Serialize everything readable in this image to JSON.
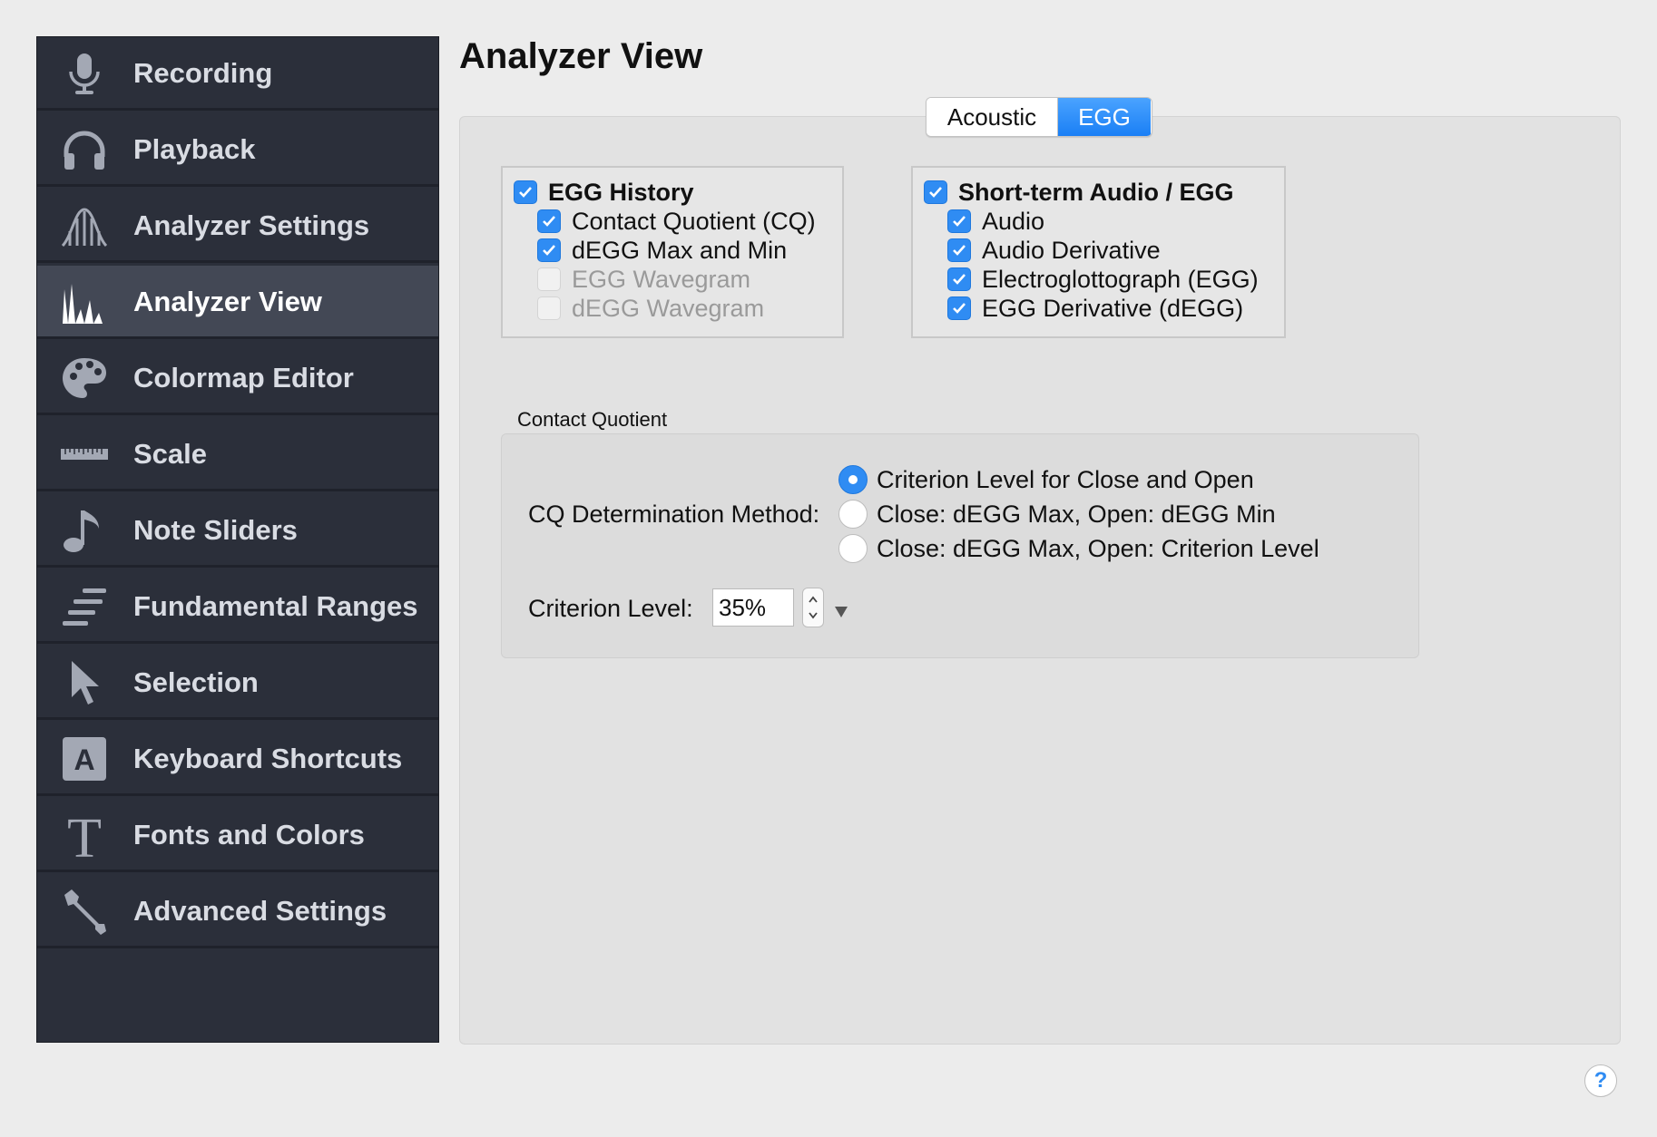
{
  "sidebar": {
    "items": [
      {
        "label": "Recording",
        "icon": "microphone-icon"
      },
      {
        "label": "Playback",
        "icon": "headphones-icon"
      },
      {
        "label": "Analyzer Settings",
        "icon": "analyzer-settings-icon"
      },
      {
        "label": "Analyzer View",
        "icon": "analyzer-view-icon",
        "active": true
      },
      {
        "label": "Colormap Editor",
        "icon": "palette-icon"
      },
      {
        "label": "Scale",
        "icon": "ruler-icon"
      },
      {
        "label": "Note Sliders",
        "icon": "music-note-icon"
      },
      {
        "label": "Fundamental Ranges",
        "icon": "ranges-icon"
      },
      {
        "label": "Selection",
        "icon": "cursor-icon"
      },
      {
        "label": "Keyboard Shortcuts",
        "icon": "keyboard-a-icon"
      },
      {
        "label": "Fonts and Colors",
        "icon": "font-t-icon"
      },
      {
        "label": "Advanced Settings",
        "icon": "wrench-icon"
      }
    ]
  },
  "page": {
    "title": "Analyzer View"
  },
  "tabs": {
    "acoustic": "Acoustic",
    "egg": "EGG",
    "selected": "EGG"
  },
  "egg_history": {
    "title": "EGG History",
    "title_checked": true,
    "items": [
      {
        "label": "Contact Quotient (CQ)",
        "checked": true,
        "enabled": true
      },
      {
        "label": "dEGG Max and Min",
        "checked": true,
        "enabled": true
      },
      {
        "label": "EGG Wavegram",
        "checked": false,
        "enabled": false
      },
      {
        "label": "dEGG Wavegram",
        "checked": false,
        "enabled": false
      }
    ]
  },
  "short_term": {
    "title": "Short-term Audio / EGG",
    "title_checked": true,
    "items": [
      {
        "label": "Audio",
        "checked": true
      },
      {
        "label": "Audio Derivative",
        "checked": true
      },
      {
        "label": "Electroglottograph (EGG)",
        "checked": true
      },
      {
        "label": "EGG Derivative (dEGG)",
        "checked": true
      }
    ]
  },
  "contact_quotient": {
    "section_label": "Contact Quotient",
    "method_label": "CQ Determination Method:",
    "methods": [
      {
        "label": "Criterion Level for Close and Open",
        "selected": true
      },
      {
        "label": "Close: dEGG Max, Open: dEGG Min",
        "selected": false
      },
      {
        "label": "Close: dEGG Max, Open: Criterion Level",
        "selected": false
      }
    ],
    "criterion_label": "Criterion Level:",
    "criterion_value": "35%"
  },
  "help": {
    "label": "?"
  },
  "colors": {
    "accent": "#2f8cf3",
    "sidebar_bg": "#2b2f3a",
    "sidebar_active": "#434855"
  }
}
